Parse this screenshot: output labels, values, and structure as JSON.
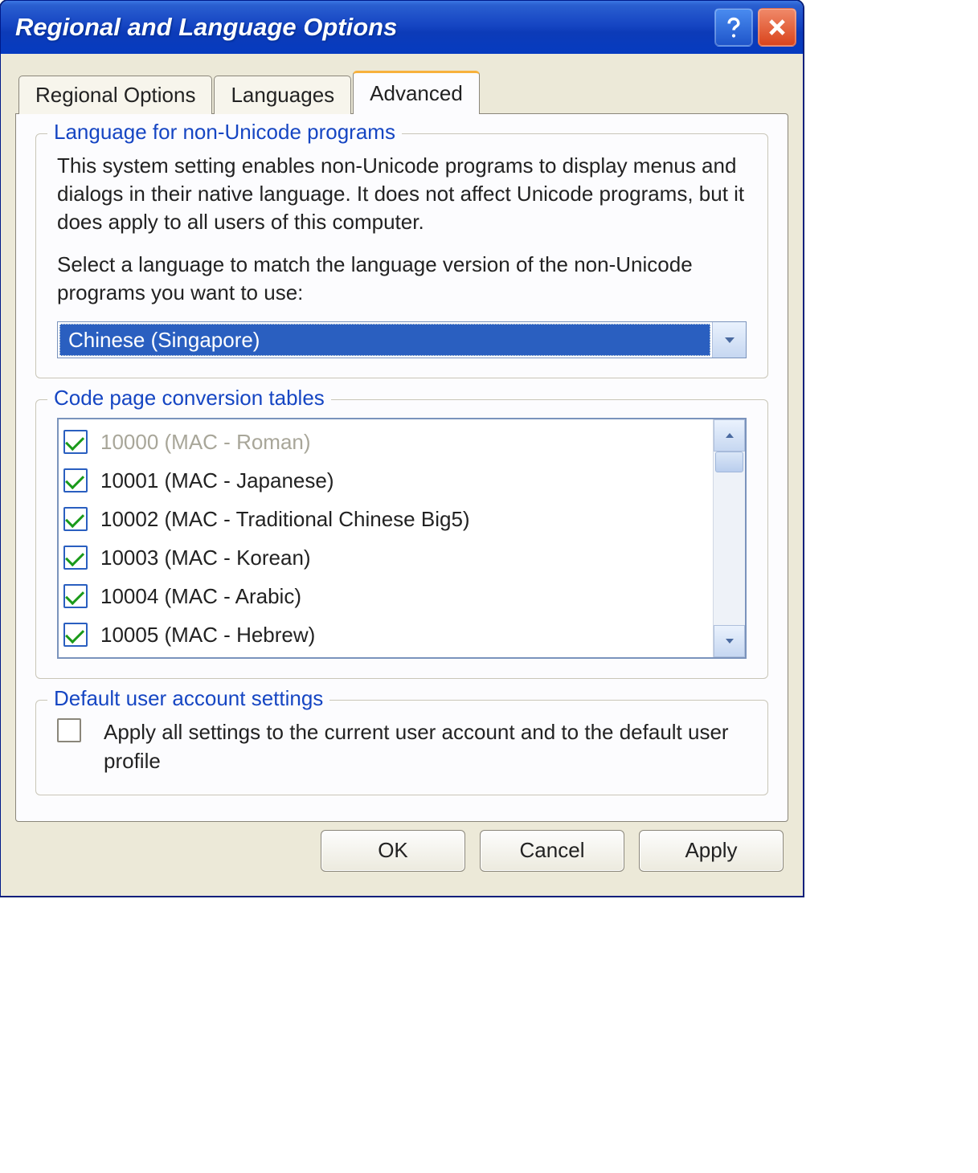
{
  "window": {
    "title": "Regional and Language Options"
  },
  "tabs": [
    {
      "label": "Regional Options"
    },
    {
      "label": "Languages"
    },
    {
      "label": "Advanced"
    }
  ],
  "group_language": {
    "legend": "Language for non-Unicode programs",
    "desc": "This system setting enables non-Unicode programs to display menus and dialogs in their native language. It does not affect Unicode programs, but it does apply to all users of this computer.",
    "prompt": "Select a language to match the language version of the non-Unicode programs you want to use:",
    "selected": "Chinese (Singapore)"
  },
  "group_codepage": {
    "legend": "Code page conversion tables",
    "items": [
      {
        "label": "10000 (MAC - Roman)",
        "checked": true,
        "disabled": true
      },
      {
        "label": "10001 (MAC - Japanese)",
        "checked": true,
        "disabled": false
      },
      {
        "label": "10002 (MAC - Traditional Chinese Big5)",
        "checked": true,
        "disabled": false
      },
      {
        "label": "10003 (MAC - Korean)",
        "checked": true,
        "disabled": false
      },
      {
        "label": "10004 (MAC - Arabic)",
        "checked": true,
        "disabled": false
      },
      {
        "label": "10005 (MAC - Hebrew)",
        "checked": true,
        "disabled": false
      }
    ]
  },
  "group_default": {
    "legend": "Default user account settings",
    "checkbox_label": "Apply all settings to the current user account and to the default user profile",
    "checked": false
  },
  "buttons": {
    "ok": "OK",
    "cancel": "Cancel",
    "apply": "Apply"
  }
}
